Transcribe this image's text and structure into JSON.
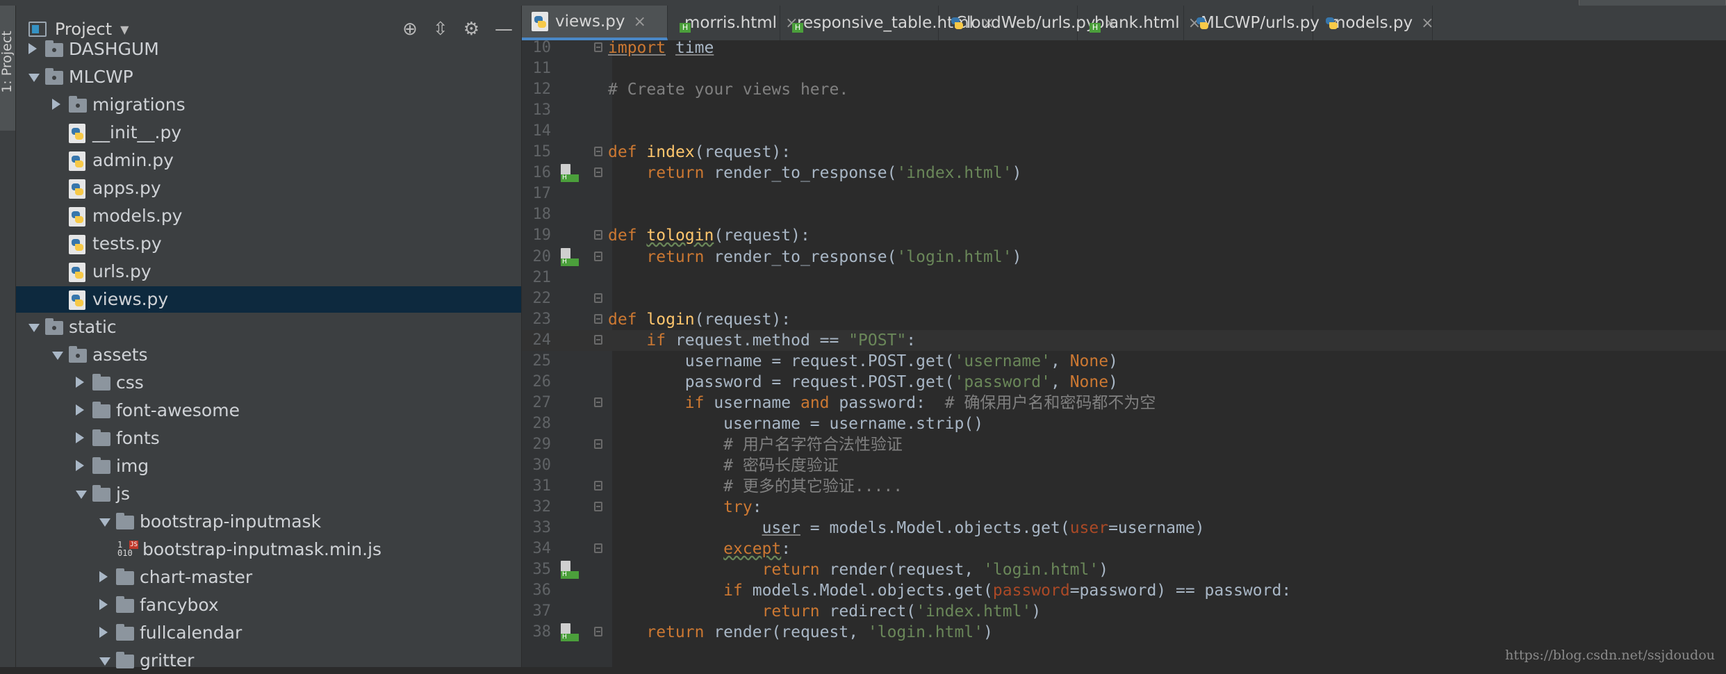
{
  "project_panel": {
    "title": "Project",
    "tree": [
      {
        "label": "DASHGUM",
        "type": "folder",
        "state": "collapsed",
        "depth": 1
      },
      {
        "label": "MLCWP",
        "type": "folder",
        "state": "expanded",
        "depth": 1
      },
      {
        "label": "migrations",
        "type": "folder",
        "state": "collapsed",
        "depth": 2
      },
      {
        "label": "__init__.py",
        "type": "py",
        "depth": 2
      },
      {
        "label": "admin.py",
        "type": "py",
        "depth": 2
      },
      {
        "label": "apps.py",
        "type": "py",
        "depth": 2
      },
      {
        "label": "models.py",
        "type": "py",
        "depth": 2
      },
      {
        "label": "tests.py",
        "type": "py",
        "depth": 2
      },
      {
        "label": "urls.py",
        "type": "py",
        "depth": 2
      },
      {
        "label": "views.py",
        "type": "py",
        "depth": 2,
        "selected": true
      },
      {
        "label": "static",
        "type": "folder",
        "state": "expanded",
        "depth": 1
      },
      {
        "label": "assets",
        "type": "folder",
        "state": "expanded",
        "depth": 2
      },
      {
        "label": "css",
        "type": "folder",
        "state": "collapsed",
        "depth": 3
      },
      {
        "label": "font-awesome",
        "type": "folder",
        "state": "collapsed",
        "depth": 3
      },
      {
        "label": "fonts",
        "type": "folder",
        "state": "collapsed",
        "depth": 3
      },
      {
        "label": "img",
        "type": "folder",
        "state": "collapsed",
        "depth": 3
      },
      {
        "label": "js",
        "type": "folder",
        "state": "expanded",
        "depth": 3
      },
      {
        "label": "bootstrap-inputmask",
        "type": "folder",
        "state": "expanded",
        "depth": 4
      },
      {
        "label": "bootstrap-inputmask.min.js",
        "type": "js",
        "depth": 5
      },
      {
        "label": "chart-master",
        "type": "folder",
        "state": "collapsed",
        "depth": 4
      },
      {
        "label": "fancybox",
        "type": "folder",
        "state": "collapsed",
        "depth": 4
      },
      {
        "label": "fullcalendar",
        "type": "folder",
        "state": "collapsed",
        "depth": 4
      },
      {
        "label": "gritter",
        "type": "folder",
        "state": "expanded",
        "depth": 4
      }
    ]
  },
  "tool_window_tab": "1: Project",
  "tabs": [
    {
      "label": "views.py",
      "type": "py",
      "active": true
    },
    {
      "label": "morris.html",
      "type": "html"
    },
    {
      "label": "responsive_table.html",
      "type": "html"
    },
    {
      "label": "CloudWeb/urls.py",
      "type": "py"
    },
    {
      "label": "blank.html",
      "type": "html"
    },
    {
      "label": "MLCWP/urls.py",
      "type": "py"
    },
    {
      "label": "models.py",
      "type": "py"
    }
  ],
  "tab_close_glyph": "×",
  "code_lines": [
    {
      "n": "10",
      "fold": true,
      "text": "import time"
    },
    {
      "n": "11",
      "text": ""
    },
    {
      "n": "12",
      "text": "# Create your views here."
    },
    {
      "n": "13",
      "text": ""
    },
    {
      "n": "14",
      "text": ""
    },
    {
      "n": "15",
      "fold": true,
      "text": "def index(request):"
    },
    {
      "n": "16",
      "mark": true,
      "fold": true,
      "text": "    return render_to_response('index.html')"
    },
    {
      "n": "17",
      "text": ""
    },
    {
      "n": "18",
      "text": ""
    },
    {
      "n": "19",
      "fold": true,
      "text": "def tologin(request):"
    },
    {
      "n": "20",
      "mark": true,
      "fold": true,
      "text": "    return render_to_response('login.html')"
    },
    {
      "n": "21",
      "text": ""
    },
    {
      "n": "22",
      "fold": true,
      "text": ""
    },
    {
      "n": "23",
      "fold": true,
      "text": "def login(request):"
    },
    {
      "n": "24",
      "fold": true,
      "current": true,
      "text": "    if request.method == \"POST\":"
    },
    {
      "n": "25",
      "text": "        username = request.POST.get('username', None)"
    },
    {
      "n": "26",
      "text": "        password = request.POST.get('password', None)"
    },
    {
      "n": "27",
      "fold": true,
      "text": "        if username and password:  # 确保用户名和密码都不为空"
    },
    {
      "n": "28",
      "text": "            username = username.strip()"
    },
    {
      "n": "29",
      "fold": true,
      "text": "            # 用户名字符合法性验证"
    },
    {
      "n": "30",
      "text": "            # 密码长度验证"
    },
    {
      "n": "31",
      "fold": true,
      "text": "            # 更多的其它验证....."
    },
    {
      "n": "32",
      "fold": true,
      "text": "            try:"
    },
    {
      "n": "33",
      "text": "                user = models.Model.objects.get(user=username)"
    },
    {
      "n": "34",
      "fold": true,
      "text": "            except:"
    },
    {
      "n": "35",
      "mark": true,
      "text": "                return render(request, 'login.html')"
    },
    {
      "n": "36",
      "text": "            if models.Model.objects.get(password=password) == password:"
    },
    {
      "n": "37",
      "text": "                return redirect('index.html')"
    },
    {
      "n": "38",
      "mark": true,
      "fold": true,
      "text": "    return render(request, 'login.html')"
    }
  ],
  "watermark": "https://blog.csdn.net/ssjdoudou",
  "colors": {
    "keyword": "#cc7832",
    "function": "#ffc66d",
    "string": "#6a8759",
    "comment": "#808080",
    "param": "#aa4926",
    "selection": "#0d293e",
    "accent": "#4a88c7"
  }
}
